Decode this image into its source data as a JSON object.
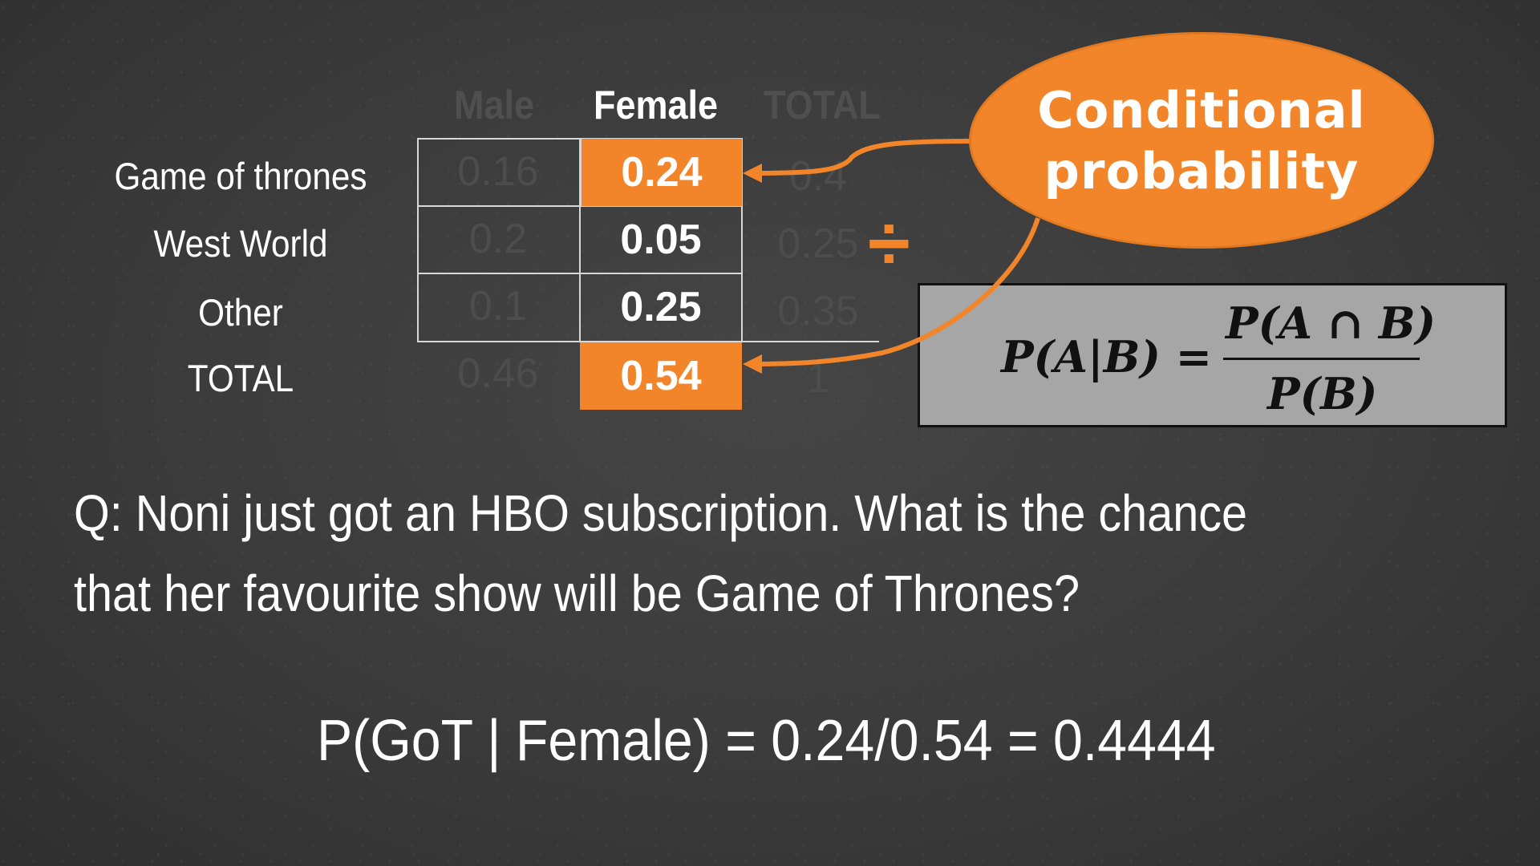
{
  "table": {
    "columns": [
      "Male",
      "Female",
      "TOTAL"
    ],
    "rows": [
      {
        "label": "Game of thrones",
        "male": "0.16",
        "female": "0.24",
        "total": "0.4"
      },
      {
        "label": "West World",
        "male": "0.2",
        "female": "0.05",
        "total": "0.25"
      },
      {
        "label": "Other",
        "male": "0.1",
        "female": "0.25",
        "total": "0.35"
      },
      {
        "label": "TOTAL",
        "male": "0.46",
        "female": "0.54",
        "total": "1"
      }
    ]
  },
  "callout": {
    "line1": "Conditional",
    "line2": "probability"
  },
  "divide_symbol": "÷",
  "formula": {
    "lhs": "P(A|B) =",
    "numerator": "P(A ∩ B)",
    "denominator": "P(B)"
  },
  "question": {
    "line1": "Q: Noni just got an HBO subscription. What is the chance",
    "line2": "that her favourite show will be Game of Thrones?"
  },
  "answer": "P(GoT | Female) = 0.24/0.54 = 0.4444",
  "colors": {
    "accent": "#f28529",
    "background": "#3a3a3a",
    "formula_box": "#a6a6a6"
  }
}
